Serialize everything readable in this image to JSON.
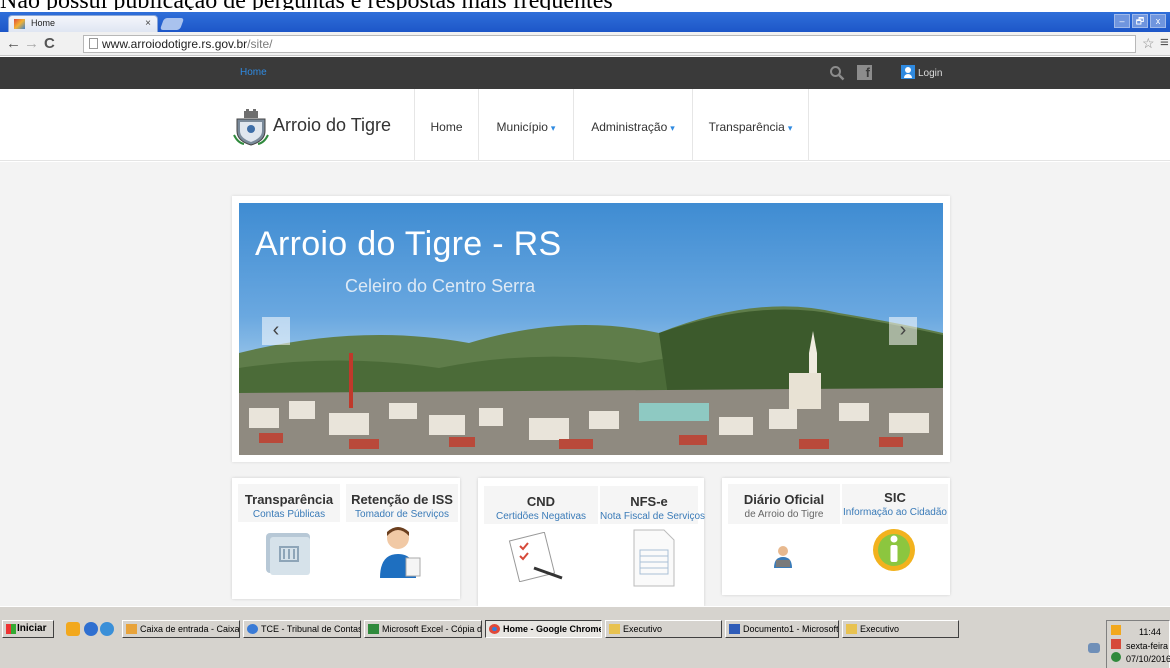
{
  "caption": "Não possui publicação de perguntas e respostas mais frequentes",
  "browser": {
    "tab_title": "Home",
    "tab_close": "×",
    "url_host": "www.arroiodotigre.rs.gov.br",
    "url_path": "/site/",
    "nav": {
      "back": "←",
      "forward": "→",
      "reload": "C"
    },
    "bookmark_star": "☆",
    "menu": "≡",
    "window_buttons": [
      "–",
      "🗗",
      "x"
    ]
  },
  "site": {
    "topbar": {
      "home_link": "Home",
      "login": "Login",
      "facebook": "f"
    },
    "brand": "Arroio do Tigre",
    "menu": [
      {
        "label": "Home",
        "dropdown": false
      },
      {
        "label": "Município",
        "dropdown": true
      },
      {
        "label": "Administração",
        "dropdown": true
      },
      {
        "label": "Transparência",
        "dropdown": true
      }
    ],
    "caret": "▾",
    "slider": {
      "title": "Arroio do Tigre - RS",
      "subtitle": "Celeiro do Centro Serra",
      "prev": "‹",
      "next": "›"
    },
    "services": [
      {
        "title": "Transparência",
        "subtitle": "Contas Públicas",
        "icon": "book-icon"
      },
      {
        "title": "Retenção de ISS",
        "subtitle": "Tomador de Serviços",
        "icon": "person-icon"
      },
      {
        "title": "CND",
        "subtitle": "Certidões Negativas",
        "icon": "checklist-icon"
      },
      {
        "title": "NFS-e",
        "subtitle": "Nota Fiscal de Serviços",
        "icon": "invoice-icon"
      },
      {
        "title": "Diário Oficial",
        "subtitle": "de Arroio do Tigre",
        "icon": "reader-icon"
      },
      {
        "title": "SIC",
        "subtitle": "Informação ao Cidadão",
        "icon": "info-icon"
      }
    ]
  },
  "taskbar": {
    "start": "Iniciar",
    "buttons": [
      {
        "label": "Caixa de entrada - Caixa...",
        "active": false,
        "color": "#e8a33a"
      },
      {
        "label": "TCE - Tribunal de Contas...",
        "active": false,
        "color": "#3a7bd6"
      },
      {
        "label": "Microsoft Excel - Cópia d...",
        "active": false,
        "color": "#2f8a3c"
      },
      {
        "label": "Home - Google Chrome",
        "active": true,
        "color": "#e0493a"
      },
      {
        "label": "Executivo",
        "active": false,
        "color": "#e8c250"
      },
      {
        "label": "Documento1 - Microsoft ...",
        "active": false,
        "color": "#2f5cb8"
      },
      {
        "label": "Executivo",
        "active": false,
        "color": "#e8c250"
      }
    ],
    "clock": {
      "time": "11:44",
      "day": "sexta-feira",
      "date": "07/10/2016"
    }
  }
}
